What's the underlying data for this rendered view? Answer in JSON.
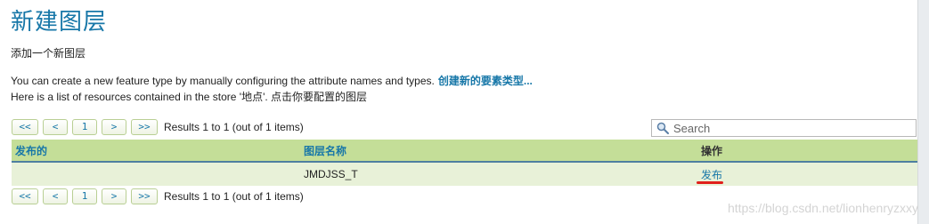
{
  "page": {
    "title": "新建图层",
    "subtitle": "添加一个新图层",
    "info_line1": "You can create a new feature type by manually configuring the attribute names and types.",
    "info_link": "创建新的要素类型...",
    "info_line2": "Here is a list of resources contained in the store '地点'. 点击你要配置的图层"
  },
  "pager": {
    "first_label": "<<",
    "prev_label": "<",
    "current_page": "1",
    "next_label": ">",
    "last_label": ">>",
    "results_text": "Results 1 to 1 (out of 1 items)"
  },
  "search": {
    "placeholder": "Search",
    "value": ""
  },
  "table": {
    "headers": [
      "发布的",
      "图层名称",
      "操作"
    ],
    "rows": [
      {
        "published": "",
        "layer_name": "JMDJSS_T",
        "action": "发布"
      }
    ]
  },
  "watermark": "https://blog.csdn.net/lionhenryzxxy",
  "colors": {
    "accent": "#1777a8",
    "header_bg": "#c4de98",
    "row_bg": "#e8f1d8",
    "highlight": "#e0201b"
  },
  "icons": {
    "search": "magnifier-icon"
  }
}
